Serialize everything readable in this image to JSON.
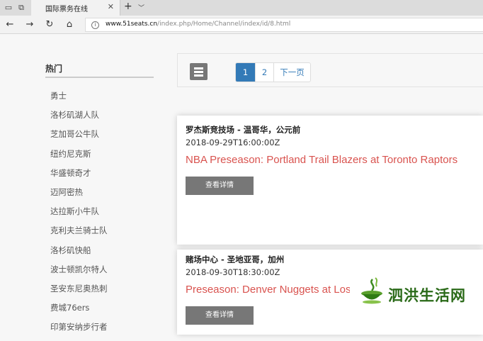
{
  "browser": {
    "tab_title": "国际票务在线",
    "url_host": "www.51seats.cn",
    "url_path": "/index.php/Home/Channel/index/id/8.html"
  },
  "sidebar": {
    "heading": "热门",
    "items": [
      "勇士",
      "洛杉矶湖人队",
      "芝加哥公牛队",
      "纽约尼克斯",
      "华盛顿奇才",
      "迈阿密热",
      "达拉斯小牛队",
      "克利夫兰骑士队",
      "洛杉矶快船",
      "波士顿凯尔特人",
      "圣安东尼奥热刺",
      "费城76ers",
      "印第安纳步行者"
    ]
  },
  "pagination": {
    "current": "1",
    "page2": "2",
    "next": "下一页"
  },
  "events": [
    {
      "venue": "罗杰斯竞技场 - 温哥华，公元前",
      "date": "2018-09-29T16:00:00Z",
      "title": "NBA Preseason: Portland Trail Blazers at Toronto Raptors",
      "button": "查看详情"
    },
    {
      "venue": "赌场中心 - 圣地亚哥，加州",
      "date": "2018-09-30T18:30:00Z",
      "title": "Preseason: Denver Nuggets at Los Angeles Clippers",
      "button": "查看详情"
    }
  ],
  "watermark": {
    "text": "泗洪生活网"
  },
  "colors": {
    "accent": "#337ab7",
    "event_title": "#d9534f",
    "button": "#777777"
  }
}
